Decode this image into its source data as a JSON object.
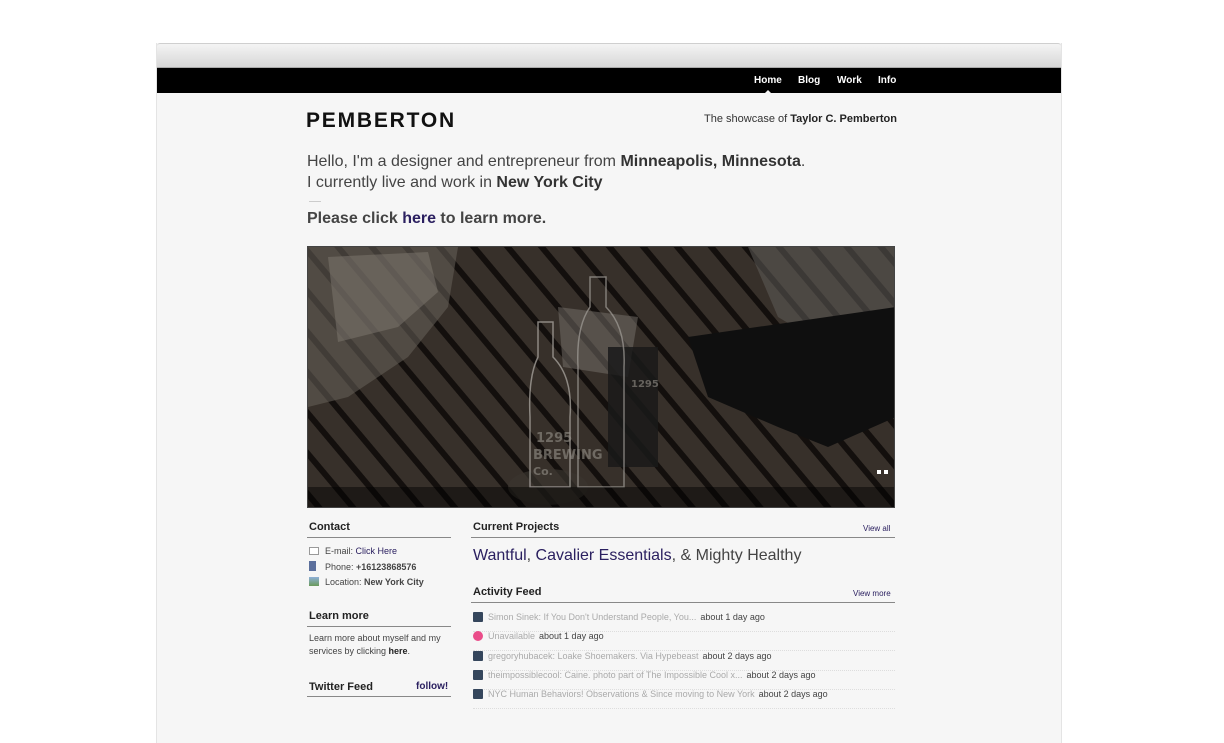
{
  "nav": {
    "items": [
      {
        "label": "Home",
        "active": true
      },
      {
        "label": "Blog",
        "active": false
      },
      {
        "label": "Work",
        "active": false
      },
      {
        "label": "Info",
        "active": false
      }
    ]
  },
  "header": {
    "logo": "PEMBERTON",
    "tagline_prefix": "The showcase of ",
    "tagline_name": "Taylor C. Pemberton"
  },
  "intro": {
    "line1_text": "Hello, I'm a designer and entrepreneur from ",
    "line1_bold": "Minneapolis, Minnesota",
    "line1_end": ".",
    "line2_text": "I currently live and work in ",
    "line2_bold": "New York City",
    "cta_prefix": "Please click ",
    "cta_link": "here",
    "cta_suffix": " to learn more."
  },
  "hero": {
    "bottle_text_1": "1295",
    "bottle_text_2": "BREWING",
    "bottle_text_3": "Co.",
    "tin_text": "1295",
    "slide_count": 2
  },
  "contact": {
    "title": "Contact",
    "email_label": "E-mail: ",
    "email_value": "Click Here",
    "phone_label": "Phone: ",
    "phone_value": "+16123868576",
    "location_label": "Location: ",
    "location_value": "New York City"
  },
  "learn_more": {
    "title": "Learn more",
    "text_1": "Learn more about myself and my",
    "text_2": "services by clicking ",
    "link": "here",
    "end": "."
  },
  "twitter": {
    "title": "Twitter Feed",
    "follow": "follow!"
  },
  "projects": {
    "title": "Current Projects",
    "view_all": "View all",
    "p1": "Wantful",
    "sep1": ", ",
    "p2": "Cavalier Essentials",
    "sep2": ", & ",
    "p3": "Mighty Healthy"
  },
  "activity": {
    "title": "Activity Feed",
    "view_more": "View more",
    "items": [
      {
        "icon": "tumblr-icon",
        "color": "#35465c",
        "text": "Simon Sinek: If You Don't Understand People, You...",
        "time": "about 1 day ago"
      },
      {
        "icon": "dribbble-icon",
        "color": "#ea4c89",
        "text": "Unavailable",
        "time": "about 1 day ago"
      },
      {
        "icon": "tumblr-icon",
        "color": "#35465c",
        "text": "gregoryhubacek: Loake Shoemakers. Via Hypebeast",
        "time": "about 2 days ago"
      },
      {
        "icon": "tumblr-icon",
        "color": "#35465c",
        "text": "theimpossiblecool: Caine. photo part of The Impossible Cool x...",
        "time": "about 2 days ago"
      },
      {
        "icon": "tumblr-icon",
        "color": "#35465c",
        "text": "NYC Human Behaviors! Observations & Since moving to New York",
        "time": "about 2 days ago"
      }
    ]
  }
}
